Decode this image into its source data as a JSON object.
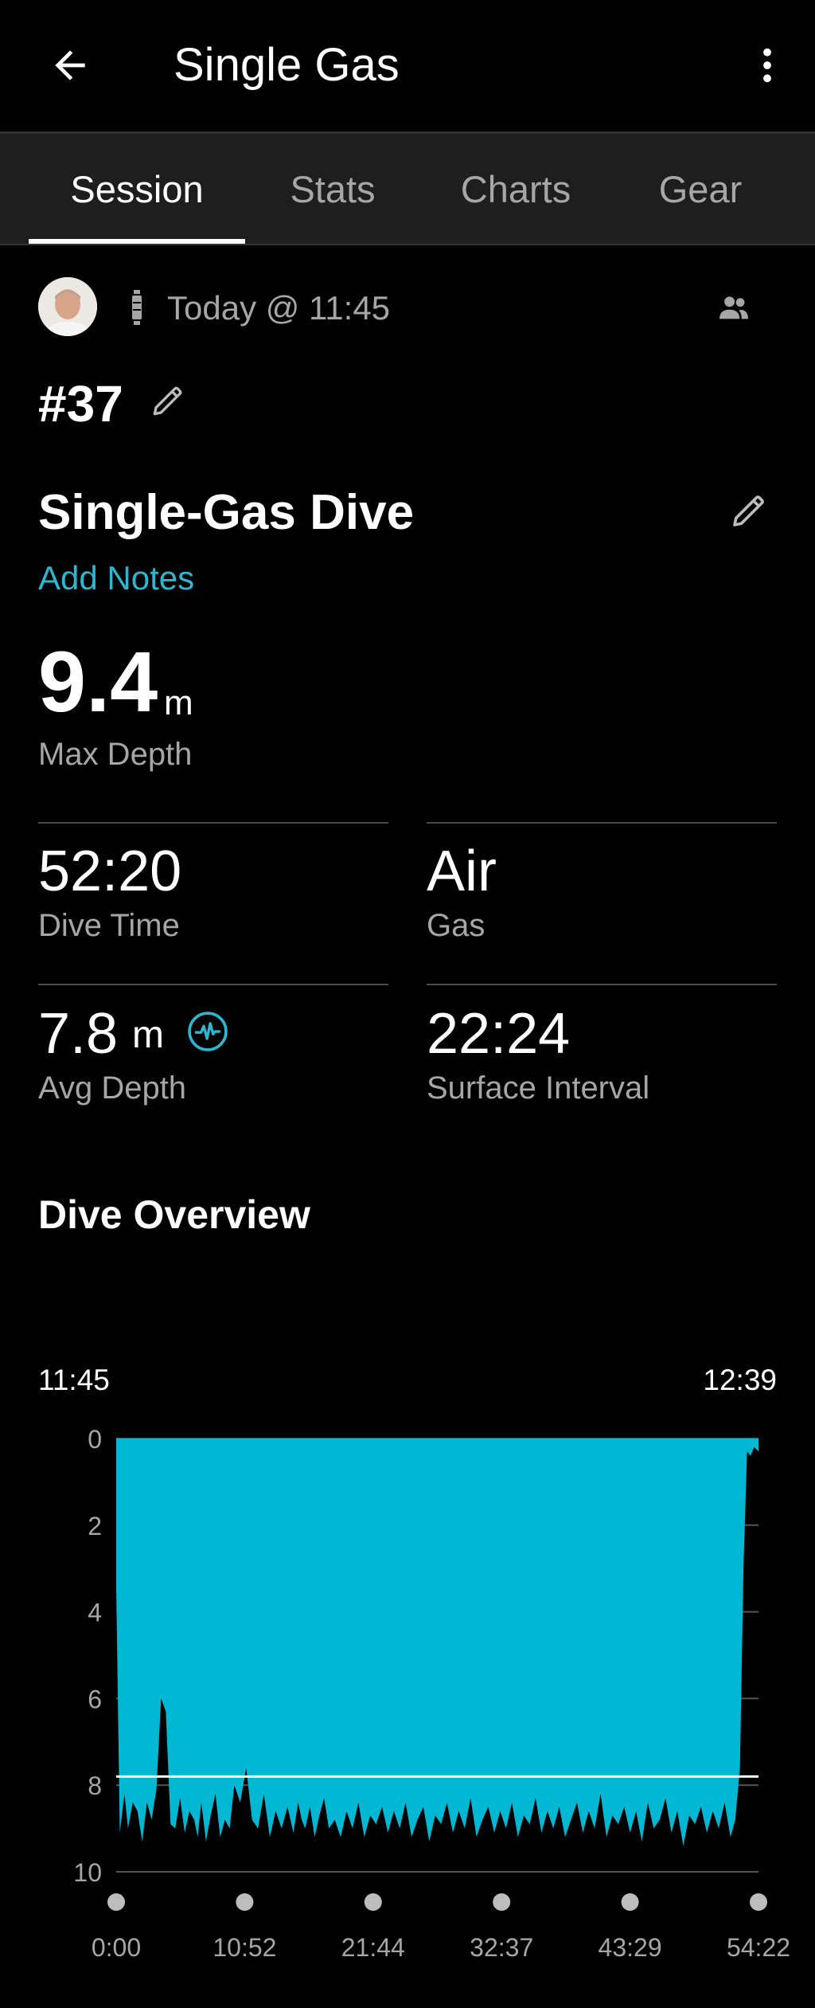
{
  "app_bar": {
    "title": "Single Gas"
  },
  "tabs": [
    {
      "label": "Session",
      "active": true
    },
    {
      "label": "Stats",
      "active": false
    },
    {
      "label": "Charts",
      "active": false
    },
    {
      "label": "Gear",
      "active": false
    }
  ],
  "session": {
    "date_text": "Today @ 11:45",
    "dive_number": "#37",
    "dive_name": "Single-Gas Dive",
    "add_notes": "Add Notes"
  },
  "max_depth": {
    "value": "9.4",
    "unit": "m",
    "label": "Max Depth"
  },
  "stats": {
    "dive_time": {
      "value": "52:20",
      "label": "Dive Time"
    },
    "gas": {
      "value": "Air",
      "label": "Gas"
    },
    "avg_depth": {
      "value": "7.8",
      "unit": "m",
      "label": "Avg Depth"
    },
    "surface_interval": {
      "value": "22:24",
      "label": "Surface Interval"
    }
  },
  "overview": {
    "title": "Dive Overview",
    "start_time": "11:45",
    "end_time": "12:39"
  },
  "colors": {
    "background": "#000000",
    "accent": "#2db6cf",
    "chart_fill": "#00b8d4",
    "secondary_text": "#a6a6a6",
    "tab_bar": "#1e1e1e"
  },
  "chart_data": {
    "type": "area",
    "title": "",
    "xlabel": "",
    "ylabel": "",
    "y_inverted": true,
    "ylim": [
      0,
      10
    ],
    "yticks": [
      "0",
      "2",
      "4",
      "6",
      "8",
      "10"
    ],
    "xticks": [
      "0:00",
      "10:52",
      "21:44",
      "32:37",
      "43:29",
      "54:22"
    ],
    "xlim_minutes": [
      0,
      54.37
    ],
    "avg_line": 7.8,
    "grid": true,
    "series": [
      {
        "values_x_minutes": [
          0,
          0.3,
          0.7,
          1.0,
          1.4,
          1.8,
          2.2,
          2.6,
          3.0,
          3.4,
          3.8,
          4.2,
          4.6,
          5.0,
          5.4,
          5.8,
          6.2,
          6.6,
          6.9,
          7.2,
          7.6,
          8.0,
          8.4,
          8.8,
          9.2,
          9.6,
          10.0,
          10.5,
          11.0,
          11.5,
          12.0,
          12.5,
          13.0,
          13.5,
          14.0,
          14.5,
          15.0,
          15.4,
          15.7,
          16.0,
          16.4,
          16.8,
          17.2,
          17.6,
          18.0,
          18.5,
          19.0,
          19.5,
          20.0,
          20.5,
          21.0,
          21.5,
          22.0,
          22.5,
          23.0,
          23.5,
          24.0,
          24.5,
          25.0,
          25.5,
          26.0,
          26.5,
          27.0,
          27.5,
          28.0,
          28.5,
          29.0,
          29.5,
          30.0,
          30.5,
          31.0,
          31.5,
          32.0,
          32.5,
          33.0,
          33.5,
          34.0,
          34.5,
          35.0,
          35.5,
          36.0,
          36.5,
          37.0,
          37.5,
          38.0,
          38.5,
          39.0,
          39.5,
          40.0,
          40.5,
          41.0,
          41.5,
          42.0,
          42.5,
          43.0,
          43.5,
          44.0,
          44.5,
          45.0,
          45.5,
          46.0,
          46.5,
          47.0,
          47.5,
          48.0,
          48.5,
          49.0,
          49.5,
          50.0,
          50.5,
          51.0,
          51.5,
          52.0,
          52.4,
          52.8,
          53.1,
          53.4,
          53.7,
          54.0,
          54.37
        ],
        "values_y_depth_m": [
          3.4,
          9.1,
          8.2,
          9.0,
          8.4,
          8.6,
          9.3,
          8.4,
          8.8,
          8.1,
          6.0,
          6.3,
          8.9,
          9.0,
          8.3,
          9.1,
          8.6,
          8.8,
          9.2,
          8.4,
          9.3,
          8.7,
          8.2,
          9.2,
          8.8,
          9.0,
          8.0,
          8.4,
          7.6,
          8.8,
          9.0,
          8.2,
          9.2,
          8.6,
          9.0,
          8.5,
          9.1,
          8.4,
          8.8,
          9.0,
          8.5,
          9.2,
          8.7,
          8.3,
          9.0,
          8.8,
          9.2,
          8.6,
          9.0,
          8.4,
          9.2,
          8.7,
          8.9,
          8.5,
          9.1,
          8.6,
          9.0,
          8.4,
          9.2,
          8.8,
          8.5,
          9.3,
          8.7,
          8.9,
          8.4,
          9.1,
          8.6,
          9.0,
          8.3,
          9.2,
          8.8,
          8.5,
          9.1,
          8.6,
          9.0,
          8.4,
          9.2,
          8.7,
          8.9,
          8.3,
          9.1,
          8.6,
          9.0,
          8.5,
          9.2,
          8.8,
          8.4,
          9.1,
          8.6,
          9.0,
          8.2,
          9.2,
          8.7,
          8.9,
          8.5,
          9.1,
          8.6,
          9.3,
          8.4,
          9.0,
          8.8,
          8.3,
          9.1,
          8.6,
          9.4,
          8.7,
          8.9,
          8.5,
          9.1,
          8.6,
          9.0,
          8.4,
          9.2,
          8.8,
          7.6,
          3.0,
          0.3,
          0.4,
          0.2,
          0.3
        ]
      }
    ]
  }
}
